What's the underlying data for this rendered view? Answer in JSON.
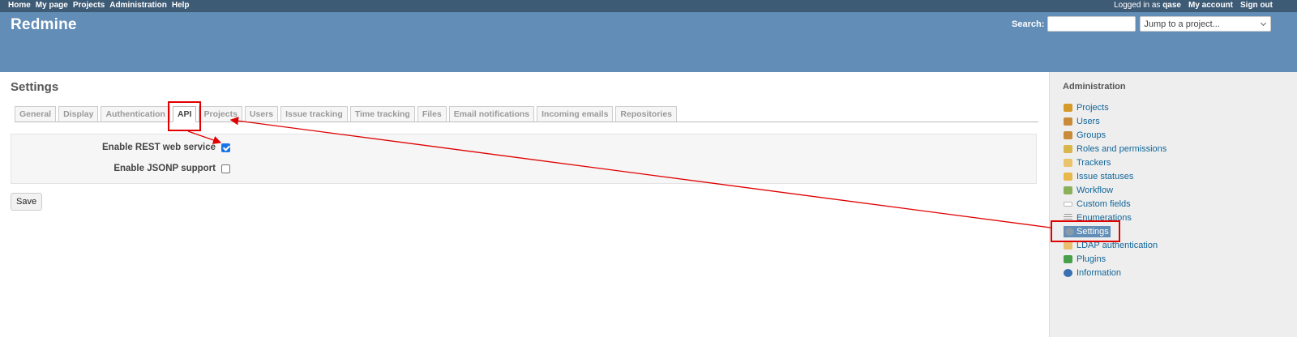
{
  "top_menu": {
    "left": [
      "Home",
      "My page",
      "Projects",
      "Administration",
      "Help"
    ],
    "logged_as_prefix": "Logged in as",
    "logged_as_user": "qase",
    "my_account": "My account",
    "sign_out": "Sign out"
  },
  "header": {
    "title": "Redmine",
    "search_label": "Search:",
    "search_value": "",
    "jump_placeholder": "Jump to a project..."
  },
  "content": {
    "title": "Settings",
    "tabs": [
      {
        "label": "General"
      },
      {
        "label": "Display"
      },
      {
        "label": "Authentication"
      },
      {
        "label": "API",
        "selected": true
      },
      {
        "label": "Projects"
      },
      {
        "label": "Users"
      },
      {
        "label": "Issue tracking"
      },
      {
        "label": "Time tracking"
      },
      {
        "label": "Files"
      },
      {
        "label": "Email notifications"
      },
      {
        "label": "Incoming emails"
      },
      {
        "label": "Repositories"
      }
    ],
    "fields": [
      {
        "label": "Enable REST web service",
        "checked": true
      },
      {
        "label": "Enable JSONP support",
        "checked": false
      }
    ],
    "save_label": "Save"
  },
  "sidebar": {
    "title": "Administration",
    "items": [
      {
        "label": "Projects",
        "icon": "projects-icon",
        "color": "#d49a2a"
      },
      {
        "label": "Users",
        "icon": "user-icon",
        "color": "#c98b3a"
      },
      {
        "label": "Groups",
        "icon": "group-icon",
        "color": "#c98b3a"
      },
      {
        "label": "Roles and permissions",
        "icon": "key-icon",
        "color": "#d8b64a"
      },
      {
        "label": "Trackers",
        "icon": "ticket-icon",
        "color": "#e9c46a"
      },
      {
        "label": "Issue statuses",
        "icon": "status-icon",
        "color": "#e9b84a"
      },
      {
        "label": "Workflow",
        "icon": "workflow-icon",
        "color": "#8bb05a"
      },
      {
        "label": "Custom fields",
        "icon": "textfield-icon",
        "color": "#ffffff"
      },
      {
        "label": "Enumerations",
        "icon": "list-icon",
        "color": "#bbbbbb"
      },
      {
        "label": "Settings",
        "icon": "gear-icon",
        "color": "#8899aa",
        "selected": true
      },
      {
        "label": "LDAP authentication",
        "icon": "ldap-icon",
        "color": "#e8c070"
      },
      {
        "label": "Plugins",
        "icon": "plugin-icon",
        "color": "#4aa04a"
      },
      {
        "label": "Information",
        "icon": "info-icon",
        "color": "#3a6fb0"
      }
    ]
  },
  "annotation_color": "#e00000"
}
